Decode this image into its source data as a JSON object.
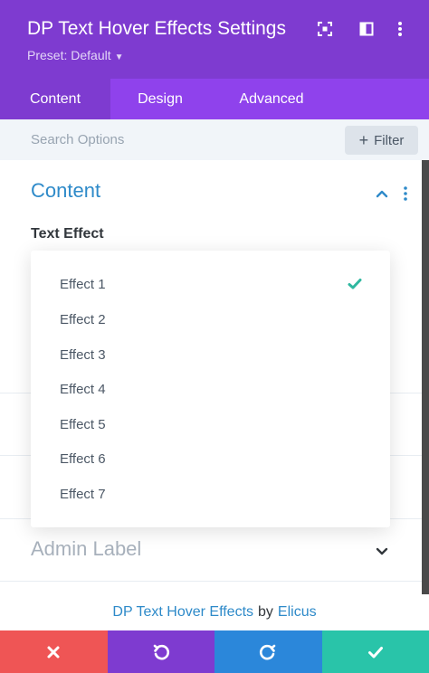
{
  "header": {
    "title": "DP Text Hover Effects Settings",
    "preset": "Preset: Default",
    "bg_color": "#7e3bd0",
    "icons": [
      "screenshot-icon",
      "sidebar-layout-icon",
      "more-vertical-icon"
    ]
  },
  "tabs": [
    {
      "label": "Content",
      "active": true
    },
    {
      "label": "Design",
      "active": false
    },
    {
      "label": "Advanced",
      "active": false
    }
  ],
  "search": {
    "placeholder": "Search Options",
    "value": "",
    "filter_label": "Filter"
  },
  "section": {
    "title": "Content",
    "field_label": "Text Effect"
  },
  "dropdown": {
    "options": [
      "Effect 1",
      "Effect 2",
      "Effect 3",
      "Effect 4",
      "Effect 5",
      "Effect 6",
      "Effect 7"
    ],
    "selected": "Effect 1",
    "check_color": "#2fb8a0"
  },
  "admin_label": "Admin Label",
  "footer": {
    "product": "DP Text Hover Effects",
    "by": "by",
    "author": "Elicus"
  },
  "actions": [
    {
      "name": "cancel-button",
      "icon": "close-icon",
      "color": "#ef5555"
    },
    {
      "name": "undo-button",
      "icon": "undo-icon",
      "color": "#7e3bd0"
    },
    {
      "name": "redo-button",
      "icon": "redo-icon",
      "color": "#2b87da"
    },
    {
      "name": "save-button",
      "icon": "check-icon",
      "color": "#29c4a9"
    }
  ],
  "colors": {
    "accent_blue": "#2e8ac9",
    "tabs_bg": "#8f42ec"
  }
}
